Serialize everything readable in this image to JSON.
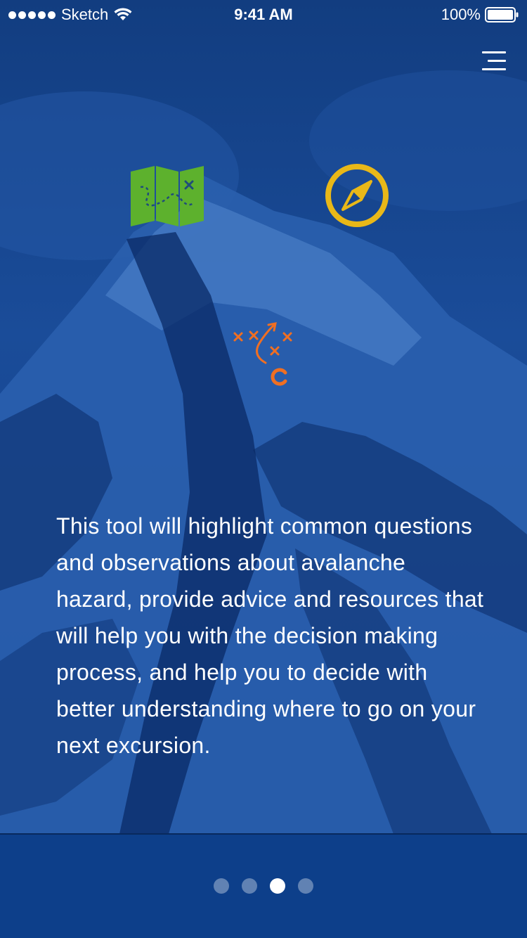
{
  "status_bar": {
    "carrier": "Sketch",
    "time": "9:41 AM",
    "battery": "100%"
  },
  "menu": {
    "icon": "hamburger-menu-icon"
  },
  "feature_icons": [
    {
      "name": "map-icon",
      "color": "#5db12d"
    },
    {
      "name": "compass-icon",
      "color": "#e9b818"
    },
    {
      "name": "game-plan-icon",
      "color": "#f06f22"
    }
  ],
  "description": "This tool will highlight common questions and observations about avalanche hazard, provide advice and resources that will help you with the decision making process, and help you to decide with better understanding where to go on your next excursion.",
  "pager": {
    "total": 4,
    "active_index": 2
  },
  "colors": {
    "background": "#103f86",
    "text": "#ffffff",
    "map": "#5db12d",
    "compass": "#e9b818",
    "plan": "#f06f22"
  }
}
